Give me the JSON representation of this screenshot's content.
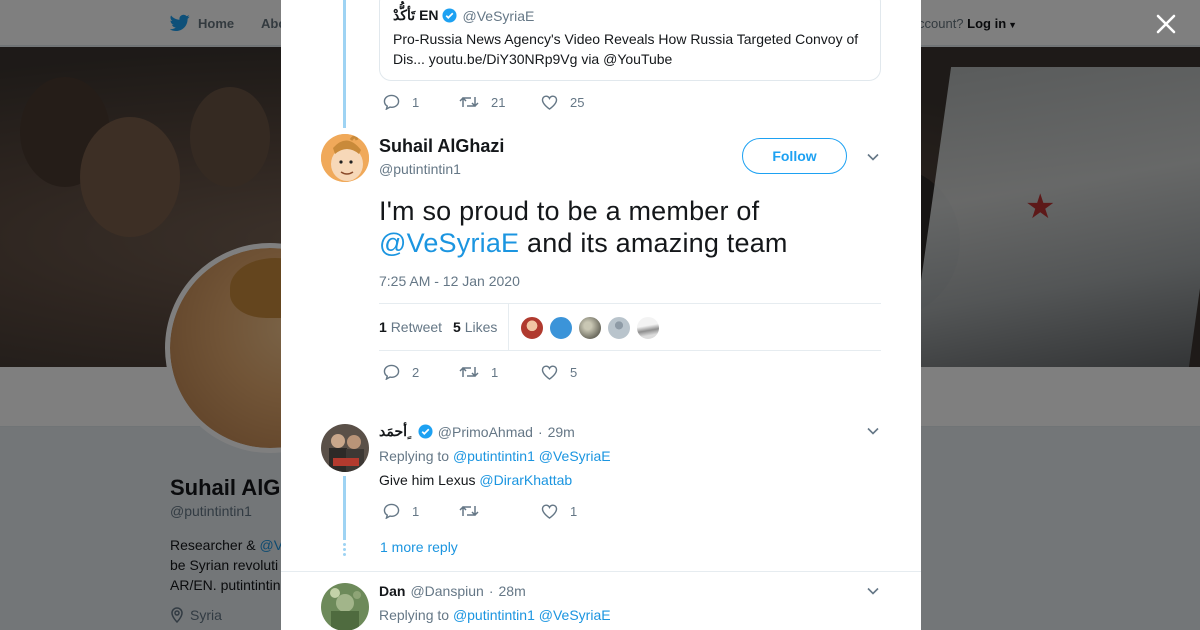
{
  "topbar": {
    "home_label": "Home",
    "about_label": "Abo",
    "account_text": "ccount?",
    "login_label": "Log in"
  },
  "profile": {
    "name": "Suhail AlGh",
    "handle": "@putintintin1",
    "bio_prefix": "Researcher & ",
    "bio_link": "@V",
    "bio_line2": "be Syrian revoluti",
    "bio_line3": "AR/EN. putintintin",
    "location": "Syria"
  },
  "quote": {
    "name": "تَأكُّدْ EN",
    "handle": "@VeSyriaE",
    "text": "Pro-Russia News Agency's Video Reveals How Russia Targeted Convoy of Dis... youtu.be/DiY30NRp9Vg via @YouTube",
    "replies": "1",
    "retweets": "21",
    "likes": "25"
  },
  "main_tweet": {
    "name": "Suhail AlGhazi",
    "handle": "@putintintin1",
    "follow_label": "Follow",
    "text_before": "I'm so proud to be a member of ",
    "mention": "@VeSyriaE",
    "text_after": " and its amazing team",
    "timestamp": "7:25 AM - 12 Jan 2020",
    "retweet_count": "1",
    "retweet_label": "Retweet",
    "like_count": "5",
    "like_label": "Likes",
    "replies": "2",
    "retweets": "1",
    "likes": "5",
    "liker_colors": [
      "#c0392b",
      "#3b94d9",
      "#8a8a7a",
      "#aab8c2",
      "#d5d9db"
    ]
  },
  "replies": [
    {
      "name": "أحمَد ٍ",
      "handle": "@PrimoAhmad",
      "time": "29m",
      "replying_to_label": "Replying to",
      "replying_to_1": "@putintintin1",
      "replying_to_2": "@VeSyriaE",
      "text": "Give him Lexus",
      "text_mention": "@DirarKhattab",
      "replies": "1",
      "retweets": "",
      "likes": "1"
    },
    {
      "name": "Dan",
      "handle": "@Danspiun",
      "time": "28m",
      "replying_to_label": "Replying to",
      "replying_to_1": "@putintintin1",
      "replying_to_2": "@VeSyriaE"
    }
  ],
  "more_replies_label": "1 more reply",
  "colors": {
    "accent": "#1da1f2",
    "link": "#1b95e0",
    "verified": "#1da1f2",
    "muted": "#657786"
  }
}
